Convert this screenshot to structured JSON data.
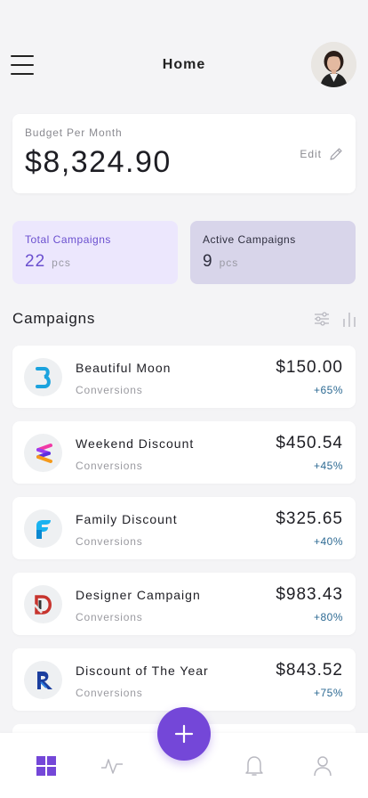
{
  "header": {
    "title": "Home",
    "menu_icon": "menu-icon",
    "avatar": "user-avatar"
  },
  "budget": {
    "label": "Budget Per Month",
    "value": "$8,324.90",
    "edit_label": "Edit",
    "edit_icon": "pencil-icon"
  },
  "stats": [
    {
      "label": "Total Campaigns",
      "value": "22",
      "unit": "pcs"
    },
    {
      "label": "Active Campaigns",
      "value": "9",
      "unit": "pcs"
    }
  ],
  "campaigns": {
    "title": "Campaigns",
    "filter_icon": "sliders-icon",
    "chart_icon": "bar-chart-icon",
    "items": [
      {
        "name": "Beautiful Moon",
        "sub": "Conversions",
        "amount": "$150.00",
        "change": "+65%",
        "logo": "b-logo-icon"
      },
      {
        "name": "Weekend Discount",
        "sub": "Conversions",
        "amount": "$450.54",
        "change": "+45%",
        "logo": "e-logo-icon"
      },
      {
        "name": "Family Discount",
        "sub": "Conversions",
        "amount": "$325.65",
        "change": "+40%",
        "logo": "f-logo-icon"
      },
      {
        "name": "Designer Campaign",
        "sub": "Conversions",
        "amount": "$983.43",
        "change": "+80%",
        "logo": "d-logo-icon"
      },
      {
        "name": "Discount of The Year",
        "sub": "Conversions",
        "amount": "$843.52",
        "change": "+75%",
        "logo": "r-logo-icon"
      }
    ]
  },
  "nav": {
    "items": [
      "dashboard-icon",
      "activity-icon",
      "bell-icon",
      "user-icon"
    ],
    "fab_icon": "plus-icon"
  },
  "colors": {
    "accent": "#7447d8",
    "background": "#f4f4f6",
    "positive_change": "#2d6a93"
  }
}
